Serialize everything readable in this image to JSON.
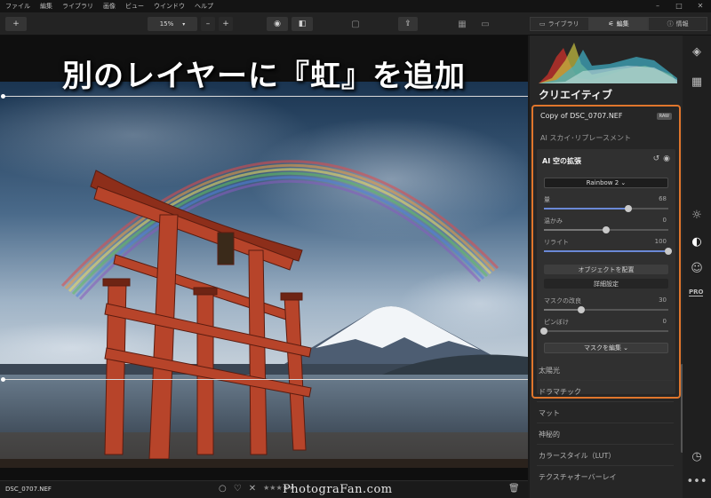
{
  "menu": [
    "ファイル",
    "編集",
    "ライブラリ",
    "画像",
    "ビュー",
    "ウインドウ",
    "ヘルプ"
  ],
  "window_controls": [
    "–",
    "□",
    "✕"
  ],
  "toolbar": {
    "add_label": "+",
    "zoom_value": "15%",
    "zoom_minus": "–",
    "zoom_plus": "+",
    "tabs": [
      {
        "icon": "▭",
        "label": "ライブラリ"
      },
      {
        "icon": "⚟",
        "label": "編集"
      },
      {
        "icon": "ⓘ",
        "label": "情報"
      }
    ]
  },
  "canvas": {
    "overlay_title": "別のレイヤーに『虹』を追加"
  },
  "status": {
    "filename": "DSC_0707.NEF",
    "rating_icons": [
      "○",
      "♡",
      "✕",
      "★★★★★"
    ],
    "watermark": "PhotograFan.com"
  },
  "panel": {
    "section_title": "クリエイティブ",
    "layer_name": "Copy of DSC_0707.NEF",
    "raw_badge": "RAW",
    "tool_above": "AI スカイ･リプレースメント",
    "tool": {
      "title": "AI 空の拡張",
      "preset": "Rainbow 2 ⌄",
      "sliders": [
        {
          "label": "量",
          "value": "68",
          "fraction": 0.68
        },
        {
          "label": "温かみ",
          "value": "0",
          "fraction": 0.5
        },
        {
          "label": "リライト",
          "value": "100",
          "fraction": 1.0
        }
      ],
      "place_objects": "オブジェクトを配置",
      "advanced": "詳細設定",
      "mask_sliders": [
        {
          "label": "マスクの改良",
          "value": "30",
          "fraction": 0.3
        },
        {
          "label": "ピンぼけ",
          "value": "0",
          "fraction": 0.0
        }
      ],
      "edit_mask": "マスクを編集 ⌄"
    },
    "list": [
      "太陽光",
      "ドラマチック",
      "マット",
      "神秘的",
      "カラースタイル（LUT）",
      "テクスチャオーバーレイ"
    ]
  },
  "colors": {
    "accent_orange": "#e0762c",
    "slider_blue": "#6a88d6"
  }
}
